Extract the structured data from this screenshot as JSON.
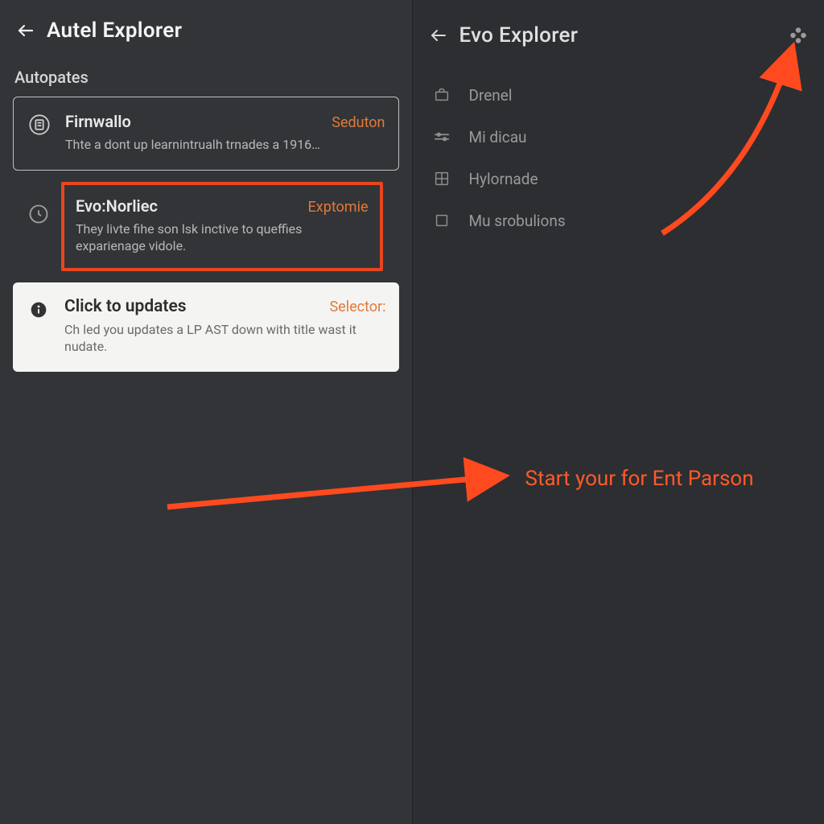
{
  "left": {
    "title": "Autel Explorer",
    "section": "Autopates",
    "cards": [
      {
        "title": "Firnwallo",
        "action": "Seduton",
        "desc": "Thte a dont up learnintrualh trnades a 1916…"
      },
      {
        "title": "Evo:Norliec",
        "action": "Exptomie",
        "desc": "They livte fihe son lsk inctive to queffies exparienage vidole."
      },
      {
        "title": "Click to updates",
        "action": "Selector:",
        "desc": "Ch led you updates a LP AST down with title wast it nudate."
      }
    ]
  },
  "right": {
    "title": "Evo Explorer",
    "menu": [
      {
        "label": "Drenel",
        "icon": "case"
      },
      {
        "label": "Mi dicau",
        "icon": "slider"
      },
      {
        "label": "Hylornade",
        "icon": "grid"
      },
      {
        "label": "Mu srobulions",
        "icon": "square"
      }
    ]
  },
  "annotation": {
    "text": "Start your for Ent Parson"
  }
}
